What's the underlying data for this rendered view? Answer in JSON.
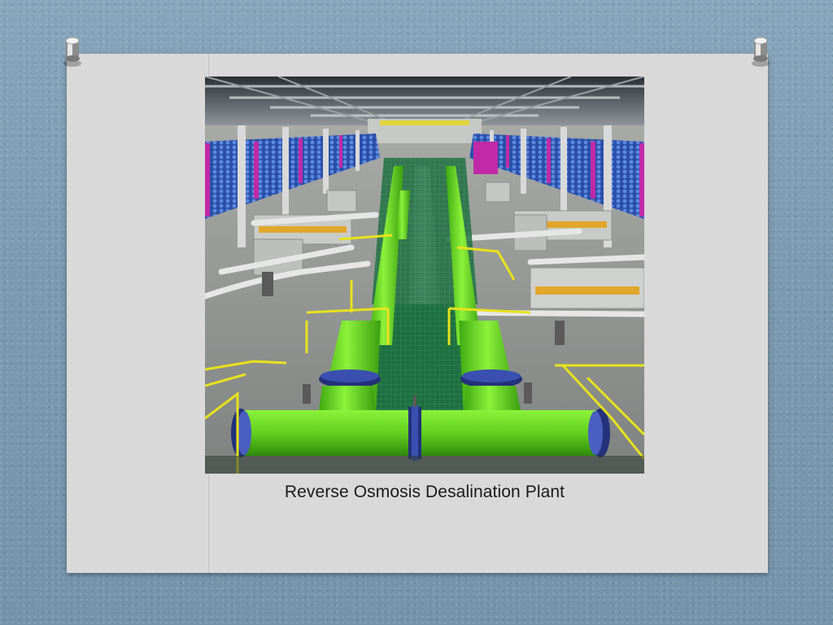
{
  "slide": {
    "caption": "Reverse Osmosis Desalination Plant"
  },
  "image": {
    "subject": "reverse-osmosis-plant-photo",
    "colors": {
      "pipe_green": "#6fdc1e",
      "flange_blue": "#2a3c8c",
      "rail_yellow": "#e8e21c",
      "grating_green": "#1f6e40",
      "ro_rack_blue": "#3a66c8",
      "frame_magenta": "#c02aa8",
      "main_pipe_white": "#e8e8e8"
    }
  },
  "background": {
    "color": "#7f9db3",
    "paper_color": "#d9d9d9"
  }
}
